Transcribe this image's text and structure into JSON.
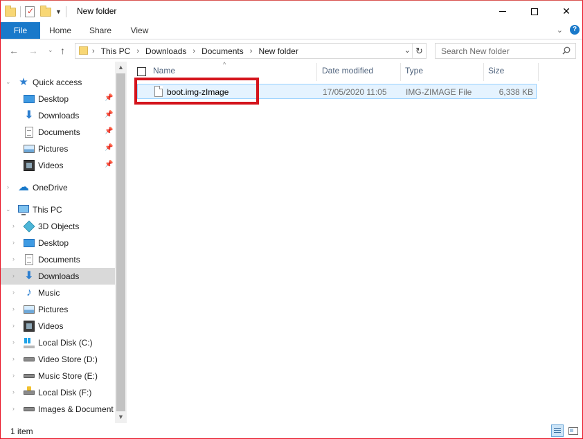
{
  "window": {
    "title": "New folder",
    "accent_color": "#1979ca",
    "highlight_color": "#d4141c"
  },
  "quick_access_toolbar": {
    "icons": [
      "folder-icon",
      "properties-icon",
      "new-folder-icon",
      "customize-dropdown-icon"
    ]
  },
  "window_controls": {
    "minimize": "minimize-icon",
    "maximize": "maximize-icon",
    "close": "✕"
  },
  "ribbon": {
    "tabs": [
      {
        "label": "File"
      },
      {
        "label": "Home"
      },
      {
        "label": "Share"
      },
      {
        "label": "View"
      }
    ],
    "help": "?"
  },
  "address_bar": {
    "breadcrumbs": [
      "This PC",
      "Downloads",
      "Documents",
      "New folder"
    ]
  },
  "search": {
    "placeholder": "Search New folder"
  },
  "nav_pane": {
    "items": [
      {
        "label": "Quick access",
        "icon": "quick-access-star-icon",
        "pinned": false
      },
      {
        "label": "Desktop",
        "icon": "desktop-icon",
        "pinned": true
      },
      {
        "label": "Downloads",
        "icon": "downloads-icon",
        "pinned": true
      },
      {
        "label": "Documents",
        "icon": "documents-icon",
        "pinned": true
      },
      {
        "label": "Pictures",
        "icon": "pictures-icon",
        "pinned": true
      },
      {
        "label": "Videos",
        "icon": "videos-icon",
        "pinned": true
      },
      {
        "label": "OneDrive",
        "icon": "onedrive-cloud-icon",
        "pinned": false
      },
      {
        "label": "This PC",
        "icon": "this-pc-icon",
        "pinned": false
      },
      {
        "label": "3D Objects",
        "icon": "3d-objects-icon",
        "pinned": false
      },
      {
        "label": "Desktop",
        "icon": "desktop-icon",
        "pinned": false
      },
      {
        "label": "Documents",
        "icon": "documents-icon",
        "pinned": false
      },
      {
        "label": "Downloads",
        "icon": "downloads-icon",
        "pinned": false,
        "selected": true
      },
      {
        "label": "Music",
        "icon": "music-icon",
        "pinned": false
      },
      {
        "label": "Pictures",
        "icon": "pictures-icon",
        "pinned": false
      },
      {
        "label": "Videos",
        "icon": "videos-icon",
        "pinned": false
      },
      {
        "label": "Local Disk (C:)",
        "icon": "windows-disk-icon",
        "pinned": false
      },
      {
        "label": "Video Store (D:)",
        "icon": "drive-icon",
        "pinned": false
      },
      {
        "label": "Music Store (E:)",
        "icon": "drive-icon",
        "pinned": false
      },
      {
        "label": "Local Disk (F:)",
        "icon": "locked-drive-icon",
        "pinned": false
      },
      {
        "label": "Images & Document",
        "icon": "drive-icon",
        "pinned": false
      }
    ]
  },
  "file_list": {
    "columns": {
      "name": "Name",
      "date_modified": "Date modified",
      "type": "Type",
      "size": "Size"
    },
    "rows": [
      {
        "name": "boot.img-zImage",
        "date_modified": "17/05/2020 11:05",
        "type": "IMG-ZIMAGE File",
        "size": "6,338 KB",
        "highlighted": true
      }
    ]
  },
  "status_bar": {
    "item_count": "1 item"
  }
}
